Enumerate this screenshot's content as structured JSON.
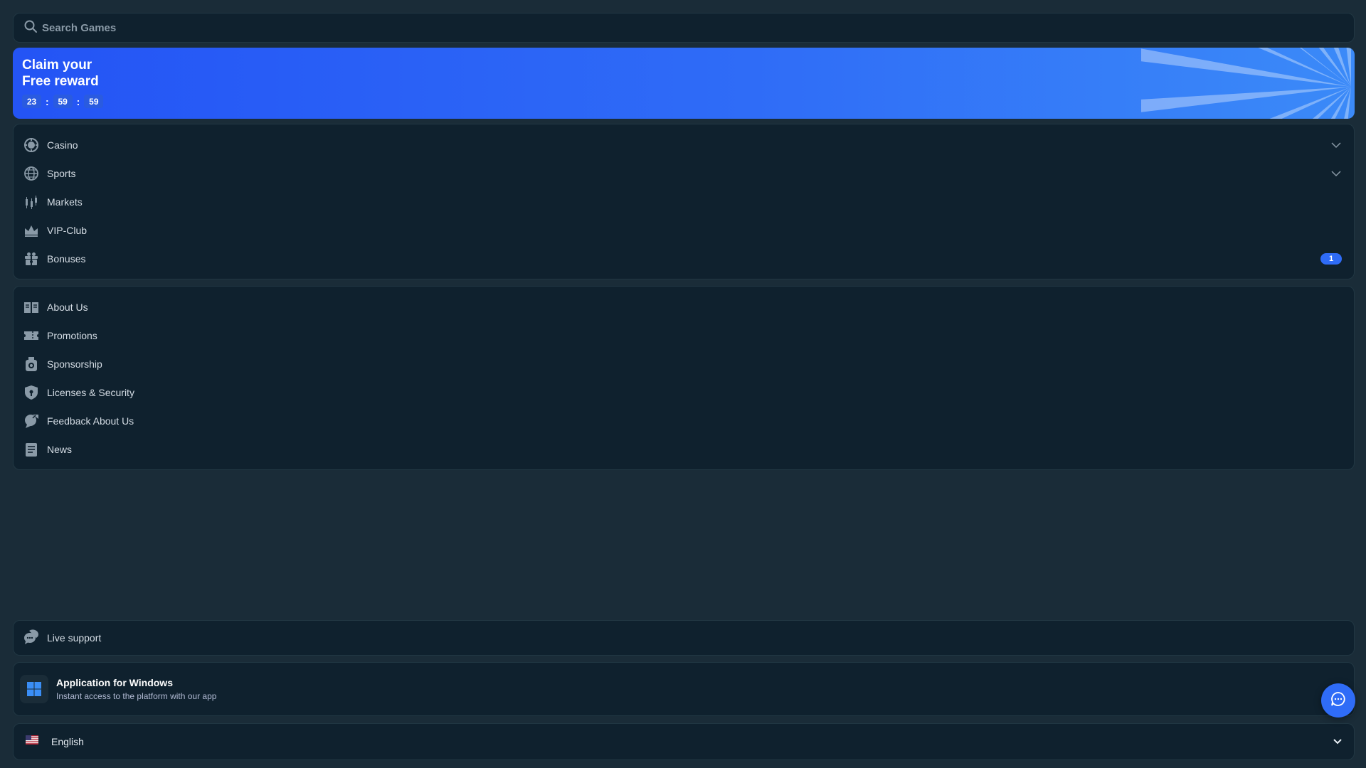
{
  "search": {
    "placeholder": "Search Games",
    "icon": "search-icon"
  },
  "banner": {
    "title_line1": "Claim your",
    "title_line2": "Free reward",
    "timer": {
      "hours": "23",
      "minutes": "59",
      "seconds": "59",
      "separator": ":"
    }
  },
  "nav_main": [
    {
      "label": "Casino",
      "icon": "casino-chip-icon",
      "chevron": true
    },
    {
      "label": "Sports",
      "icon": "globe-icon",
      "chevron": true
    },
    {
      "label": "Markets",
      "icon": "candlestick-icon"
    },
    {
      "label": "VIP-Club",
      "icon": "crown-icon"
    },
    {
      "label": "Bonuses",
      "icon": "gift-icon",
      "badge": "1"
    }
  ],
  "nav_info": [
    {
      "label": "About Us",
      "icon": "book-icon"
    },
    {
      "label": "Promotions",
      "icon": "ticket-icon"
    },
    {
      "label": "Sponsorship",
      "icon": "medal-icon"
    },
    {
      "label": "Licenses & Security",
      "icon": "shield-icon"
    },
    {
      "label": "Feedback About Us",
      "icon": "feedback-icon"
    },
    {
      "label": "News",
      "icon": "newspaper-icon"
    }
  ],
  "support": {
    "label": "Live support",
    "icon": "chat-bubbles-icon"
  },
  "app_promo": {
    "title": "Application for Windows",
    "subtitle": "Instant access to the platform with our app",
    "icon": "windows-icon"
  },
  "language": {
    "label": "English",
    "flag": "us-flag-icon"
  },
  "colors": {
    "background": "#1a2c38",
    "panel": "#0f212e",
    "accent": "#2f6cf7"
  }
}
